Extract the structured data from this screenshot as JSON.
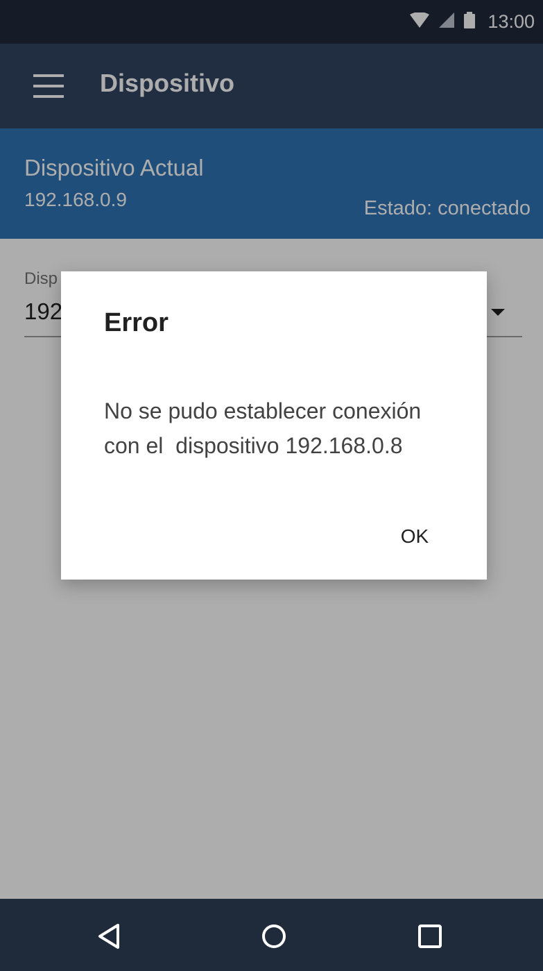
{
  "status_bar": {
    "time": "13:00",
    "icons": [
      "wifi-icon",
      "cell-signal-icon",
      "battery-icon"
    ]
  },
  "app_bar": {
    "title": "Dispositivo",
    "menu_icon": "hamburger-menu-icon"
  },
  "current_device": {
    "label": "Dispositivo Actual",
    "ip": "192.168.0.9",
    "status": "Estado: conectado"
  },
  "selector": {
    "label": "Disp",
    "value": "192"
  },
  "dialog": {
    "title": "Error",
    "message": "No se pudo establecer conexión\ncon el  dispositivo 192.168.0.8",
    "ok_label": "OK"
  },
  "nav_bar": {
    "icons": [
      "back-icon",
      "home-icon",
      "recents-icon"
    ]
  },
  "colors": {
    "status_bar": "#1f2a3b",
    "app_bar": "#314460",
    "current_card": "#2e74b5",
    "nav_bar": "#1f2a3b",
    "dialog_bg": "#ffffff"
  }
}
